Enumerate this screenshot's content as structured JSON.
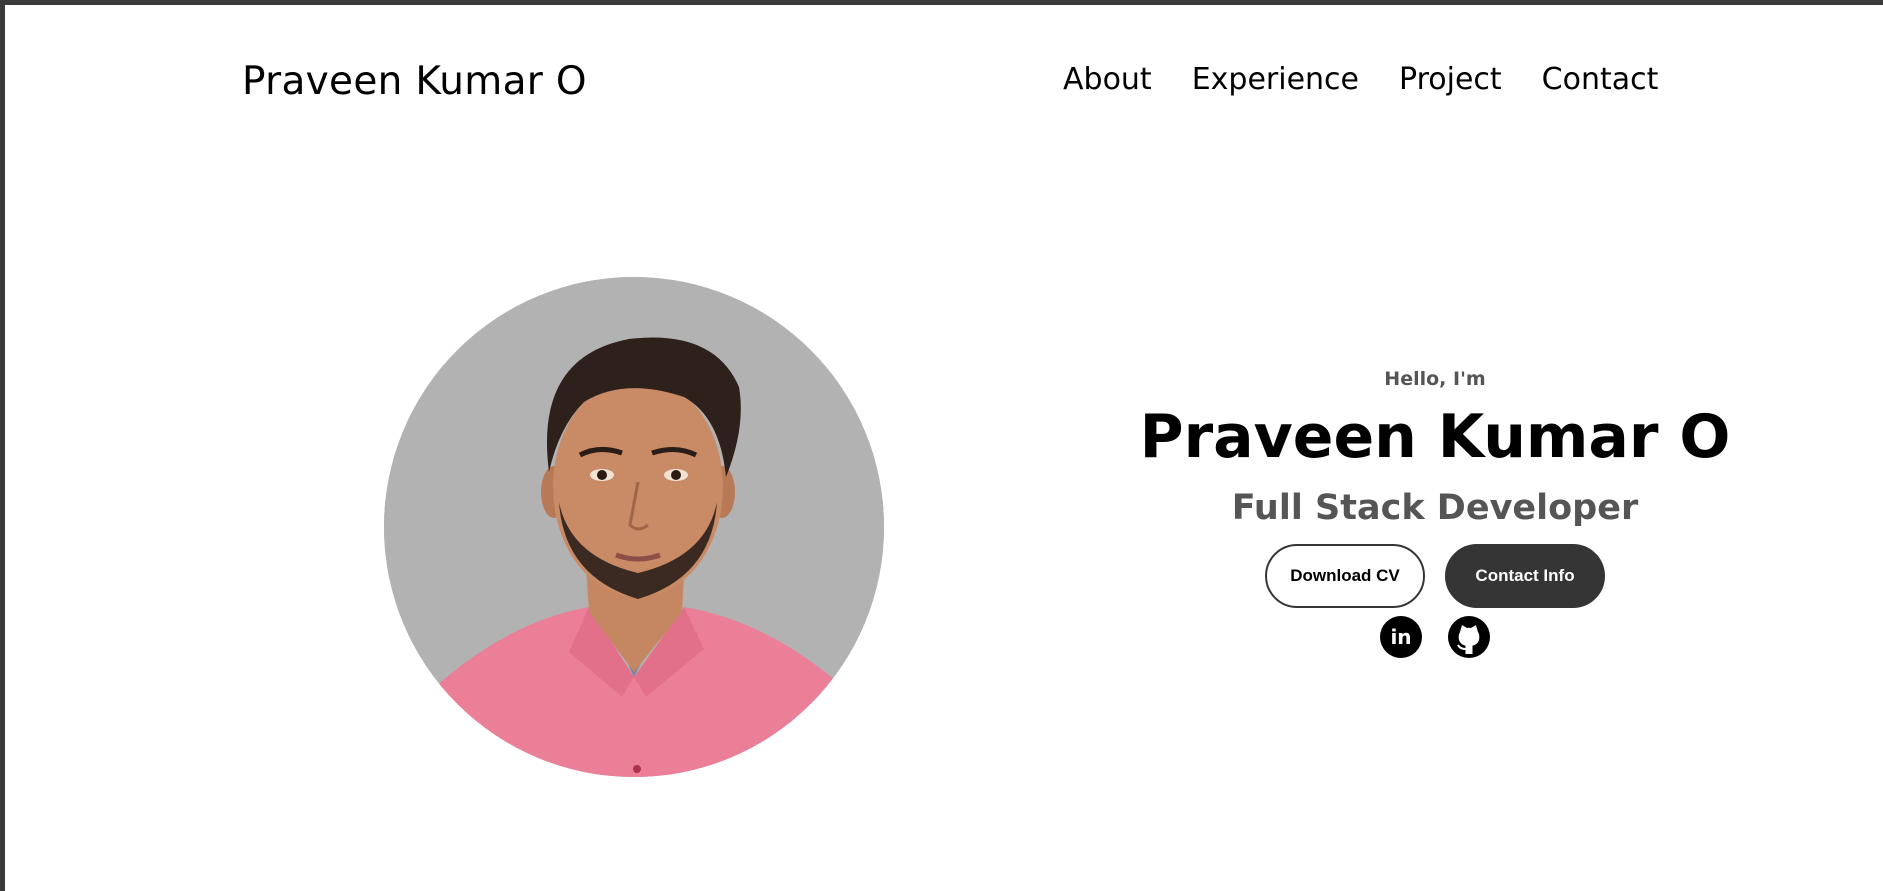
{
  "nav": {
    "brand": "Praveen Kumar O",
    "links": [
      "About",
      "Experience",
      "Project",
      "Contact"
    ]
  },
  "hero": {
    "greeting": "Hello, I'm",
    "name": "Praveen Kumar O",
    "role": "Full Stack Developer",
    "buttons": {
      "download_cv": "Download CV",
      "contact_info": "Contact Info"
    },
    "socials": {
      "linkedin_text": "in",
      "icons": [
        "linkedin-icon",
        "github-icon"
      ]
    }
  },
  "colors": {
    "background": "#ffffff",
    "frame": "#3a3a3a",
    "dark_button": "#353535",
    "muted_text": "#555555",
    "portrait_bg": "#b3b2b3",
    "shirt": "#ec7f98"
  }
}
